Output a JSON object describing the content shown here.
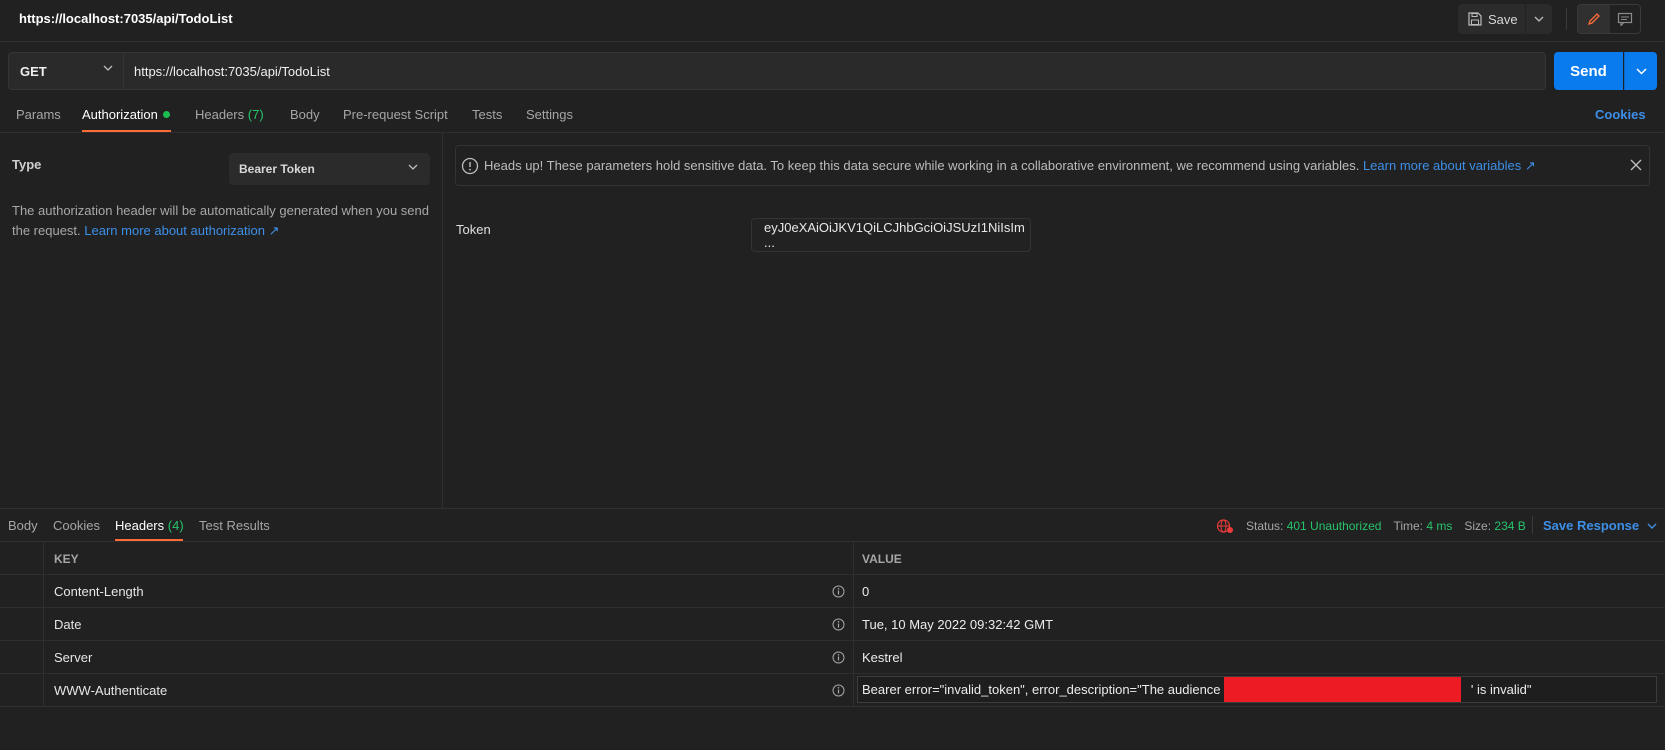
{
  "titlebar": {
    "title": "https://localhost:7035/api/TodoList",
    "save_label": "Save"
  },
  "request": {
    "method": "GET",
    "url": "https://localhost:7035/api/TodoList",
    "send_label": "Send"
  },
  "tabs": {
    "params": "Params",
    "authorization": "Authorization",
    "headers": "Headers",
    "headers_count": "(7)",
    "body": "Body",
    "prerequest": "Pre-request Script",
    "tests": "Tests",
    "settings": "Settings",
    "cookies": "Cookies"
  },
  "auth": {
    "type_label": "Type",
    "type_value": "Bearer Token",
    "desc_text": "The authorization header will be automatically generated when you send the request.",
    "desc_link": "Learn more about authorization ↗",
    "banner_text": "Heads up! These parameters hold sensitive data. To keep this data secure while working in a collaborative environment, we recommend using variables.",
    "banner_link": "Learn more about variables ↗",
    "token_label": "Token",
    "token_value": "eyJ0eXAiOiJKV1QiLCJhbGciOiJSUzI1NiIsIm ..."
  },
  "response": {
    "tabs": {
      "body": "Body",
      "cookies": "Cookies",
      "headers": "Headers",
      "headers_count": "(4)",
      "test_results": "Test Results"
    },
    "status_label": "Status:",
    "status_value": "401 Unauthorized",
    "time_label": "Time:",
    "time_value": "4 ms",
    "size_label": "Size:",
    "size_value": "234 B",
    "save_response": "Save Response",
    "table": {
      "key_header": "KEY",
      "value_header": "VALUE",
      "rows": [
        {
          "key": "Content-Length",
          "value": "0"
        },
        {
          "key": "Date",
          "value": "Tue, 10 May 2022 09:32:42 GMT"
        },
        {
          "key": "Server",
          "value": "Kestrel"
        },
        {
          "key": "WWW-Authenticate",
          "value_prefix": "Bearer error=\"invalid_token\", error_description=\"The audience '7",
          "value_suffix": "' is invalid\""
        }
      ]
    }
  },
  "colors": {
    "accent_orange": "#ff6c37",
    "send_blue": "#097bed",
    "link_blue": "#3d8fe8",
    "status_green": "#27c46b",
    "redaction_red": "#ed1c24"
  }
}
